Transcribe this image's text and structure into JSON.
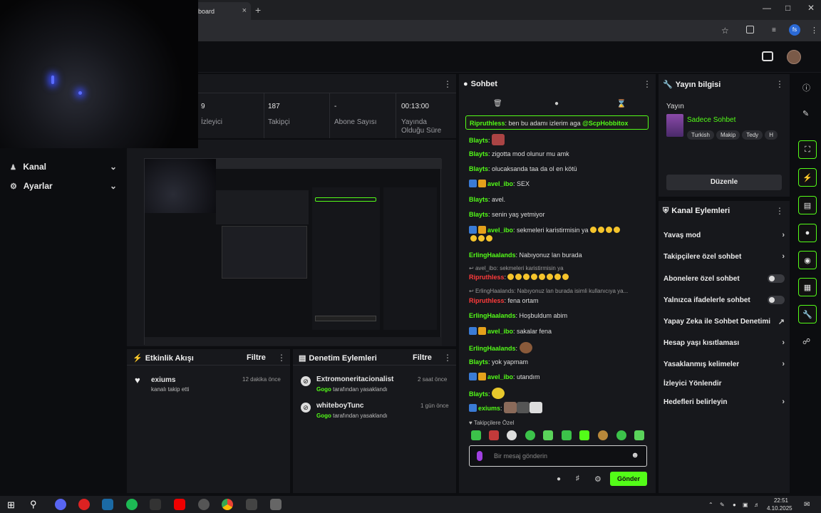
{
  "browser": {
    "tab_title": "board",
    "new_tab": "+",
    "close": "×",
    "profile": "fs"
  },
  "sidebar": {
    "items": [
      {
        "label": "Kanal"
      },
      {
        "label": "Ayarlar"
      }
    ]
  },
  "stats": [
    {
      "value": "9",
      "label": "İzleyici"
    },
    {
      "value": "187",
      "label": "Takipçi"
    },
    {
      "value": "-",
      "label": "Abone Sayısı"
    },
    {
      "value": "00:13:00",
      "label": "Yayında Olduğu Süre"
    }
  ],
  "activity": {
    "title": "Etkinlik Akışı",
    "filter": "Filtre",
    "items": [
      {
        "user": "exiums",
        "text": "kanalı takip etti",
        "time": "12 dakika önce"
      }
    ]
  },
  "moderation": {
    "title": "Denetim Eylemleri",
    "filter": "Filtre",
    "items": [
      {
        "user": "Extromoneritacionalist",
        "by": "Gogo",
        "action": "tarafından yasaklandı",
        "time": "2 saat önce"
      },
      {
        "user": "whiteboyTunc",
        "by": "Gogo",
        "action": "tarafından yasaklandı",
        "time": "1 gün önce"
      }
    ]
  },
  "chat": {
    "title": "Sohbet",
    "pinned": {
      "user": "Ripruthless",
      "text": ": ben bu adamı izlerim aga ",
      "mention": "@ScpHobbitox"
    },
    "messages": [
      {
        "user": "Blayts",
        "text": ":",
        "color": "green"
      },
      {
        "user": "Blayts",
        "text": ": zigotta mod olunur mu amk",
        "color": "green"
      },
      {
        "user": "Blayts",
        "text": ": olucaksanda taa da ol en kötü",
        "color": "green"
      },
      {
        "user": "avel_ibo",
        "text": ": SEX",
        "color": "green"
      },
      {
        "user": "Blayts",
        "text": ": avel.",
        "color": "green"
      },
      {
        "user": "Blayts",
        "text": ": senin yaş yetmiyor",
        "color": "green"
      },
      {
        "user": "avel_ibo",
        "text": ": sekmeleri karistirmisin ya",
        "color": "green"
      },
      {
        "user": "ErlingHaalands",
        "text": ": Nabıyonuz lan burada",
        "color": "green"
      },
      {
        "user": "avel_ibo",
        "text": ": sekmeleri karistirmisin ya",
        "color": "reply"
      },
      {
        "user": "Ripruthless",
        "text": ":",
        "color": "red"
      },
      {
        "user": "ErlingHaalands",
        "text": ": Nabıyonuz lan burada isimli kullanıcıya ya...",
        "color": "reply"
      },
      {
        "user": "Ripruthless",
        "text": ": fena ortam",
        "color": "red"
      },
      {
        "user": "ErlingHaalands",
        "text": ": Hoşbuldum abim",
        "color": "green"
      },
      {
        "user": "avel_ibo",
        "text": ": sakalar fena",
        "color": "green"
      },
      {
        "user": "ErlingHaalands",
        "text": ":",
        "color": "green"
      },
      {
        "user": "Blayts",
        "text": ": yok yapmam",
        "color": "green"
      },
      {
        "user": "avel_ibo",
        "text": ": utandım",
        "color": "green"
      },
      {
        "user": "Blayts",
        "text": ":",
        "color": "green"
      },
      {
        "user": "exiums",
        "text": ":",
        "color": "green"
      }
    ],
    "followers_only": "Takipçilere Özel",
    "input_placeholder": "Bir mesaj gönderin",
    "send": "Gönder"
  },
  "stream_info": {
    "title": "Yayın bilgisi",
    "label": "Yayın",
    "category": "Sadece Sohbet",
    "tags": [
      "Turkish",
      "Makip",
      "Tedy",
      "H"
    ],
    "edit": "Düzenle"
  },
  "channel_actions": {
    "title": "Kanal Eylemleri",
    "items": [
      {
        "label": "Yavaş mod",
        "kind": "chevron"
      },
      {
        "label": "Takipçilere özel sohbet",
        "kind": "chevron"
      },
      {
        "label": "Abonelere özel sohbet",
        "kind": "toggle"
      },
      {
        "label": "Yalnızca ifadelerle sohbet",
        "kind": "toggle"
      },
      {
        "label": "Yapay Zeka ile Sohbet Denetimi",
        "kind": "external"
      },
      {
        "label": "Hesap yaşı kısıtlaması",
        "kind": "chevron"
      },
      {
        "label": "Yasaklanmış kelimeler",
        "kind": "chevron"
      },
      {
        "label": "İzleyici Yönlendir",
        "kind": "none"
      },
      {
        "label": "Hedefleri belirleyin",
        "kind": "chevron"
      }
    ]
  },
  "taskbar": {
    "time": "22:51",
    "date": "4.10.2025"
  },
  "colors": {
    "accent": "#53fc18",
    "panel": "#17181c",
    "background": "#0c0d10"
  }
}
